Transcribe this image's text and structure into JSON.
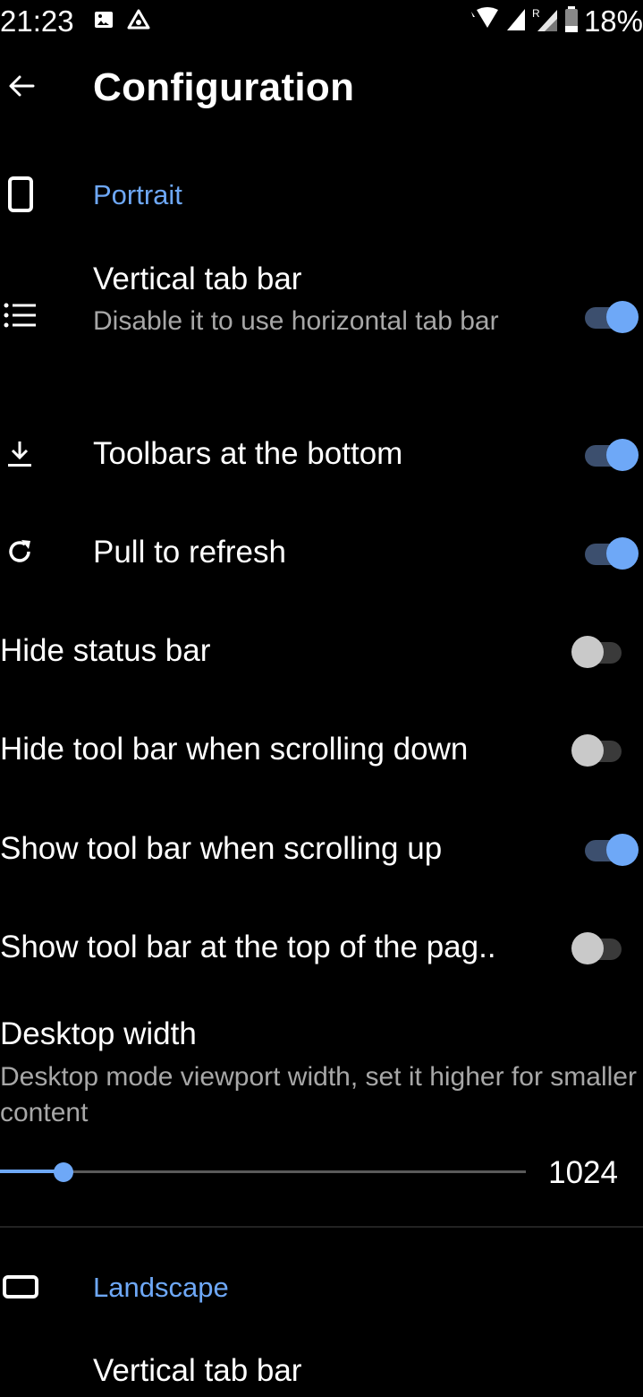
{
  "status_bar": {
    "time": "21:23",
    "battery": "18%",
    "left_icons": [
      "image-icon",
      "app-notification-icon"
    ],
    "right_icons": [
      "wifi-icon",
      "signal-icon",
      "roaming-signal-icon",
      "battery-icon"
    ]
  },
  "app_bar": {
    "title": "Configuration"
  },
  "portrait": {
    "section_title": "Portrait",
    "vertical_tab_bar": {
      "title": "Vertical tab bar",
      "subtitle": "Disable it to use horizontal tab bar",
      "enabled": true
    },
    "toolbars_bottom": {
      "title": "Toolbars at the bottom",
      "enabled": true
    },
    "pull_to_refresh": {
      "title": "Pull to refresh",
      "enabled": true
    },
    "hide_status_bar": {
      "title": "Hide status bar",
      "enabled": false
    },
    "hide_toolbar_scroll_down": {
      "title": "Hide tool bar when scrolling down",
      "enabled": false
    },
    "show_toolbar_scroll_up": {
      "title": "Show tool bar when scrolling up",
      "enabled": true
    },
    "show_toolbar_top": {
      "title": "Show tool bar at the top of the pag..",
      "enabled": false
    },
    "desktop_width": {
      "title": "Desktop width",
      "subtitle": "Desktop mode viewport width, set it higher for smaller content",
      "value": "1024",
      "fraction": 0.12
    }
  },
  "landscape": {
    "section_title": "Landscape",
    "vertical_tab_bar": {
      "title": "Vertical tab bar"
    }
  },
  "colors": {
    "background": "#000000",
    "accent": "#6ea8f7",
    "text_primary": "#ffffff",
    "text_secondary": "#a7a7a7"
  }
}
